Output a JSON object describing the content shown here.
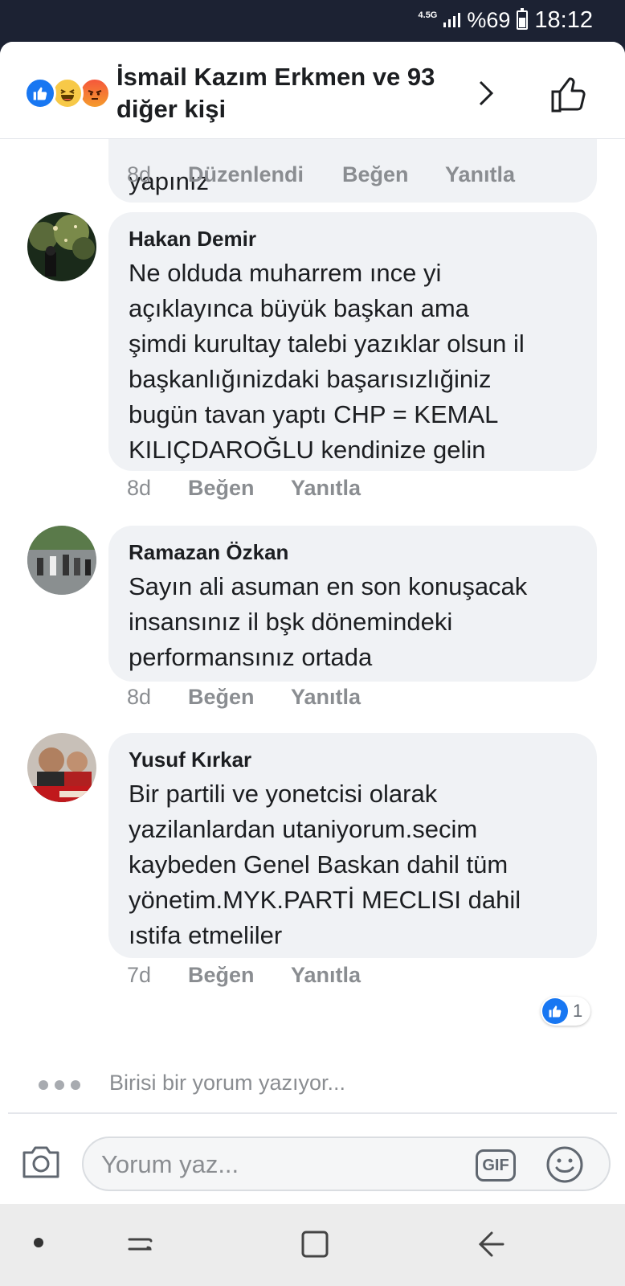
{
  "status_bar": {
    "network": "4.5G",
    "battery": "%69",
    "time": "18:12"
  },
  "header": {
    "title": "İsmail Kazım Erkmen ve 93 diğer kişi",
    "reactions": [
      "like-icon",
      "haha-icon",
      "angry-icon"
    ]
  },
  "previous_comment": {
    "text_tail": "yapınız",
    "time": "8d",
    "edited_label": "Düzenlendi",
    "like_label": "Beğen",
    "reply_label": "Yanıtla"
  },
  "comments": [
    {
      "author": "Hakan Demir",
      "text": "Ne olduda muharrem ınce yi\naçıklayınca büyük başkan ama\nşimdi kurultay talebi yazıklar olsun il\nbaşkanlığınizdaki başarısızlığiniz\nbugün tavan yaptı CHP = KEMAL\nKILIÇDAROĞLU kendinize  gelin",
      "time": "8d",
      "like_label": "Beğen",
      "reply_label": "Yanıtla"
    },
    {
      "author": "Ramazan Özkan",
      "text": "Sayın ali asuman en son konuşacak\ninsansınız il bşk dönemindeki\nperformansınız ortada",
      "time": "8d",
      "like_label": "Beğen",
      "reply_label": "Yanıtla"
    },
    {
      "author": "Yusuf Kırkar",
      "text": "Bir partili ve yonetcisi olarak\nyazilanlardan utaniyorum.secim\nkaybeden Genel Baskan dahil tüm\nyönetim.MYK.PARTİ MECLISI dahil\nıstifa etmeliler",
      "time": "7d",
      "like_label": "Beğen",
      "reply_label": "Yanıtla",
      "like_count": "1"
    }
  ],
  "typing_indicator": "Birisi bir yorum yazıyor...",
  "composer": {
    "placeholder": "Yorum yaz...",
    "gif_label": "GIF"
  },
  "colors": {
    "accent": "#1877f2",
    "bubble": "#f0f2f5",
    "meta": "#8a8d91",
    "status_bar": "#1c2233"
  }
}
